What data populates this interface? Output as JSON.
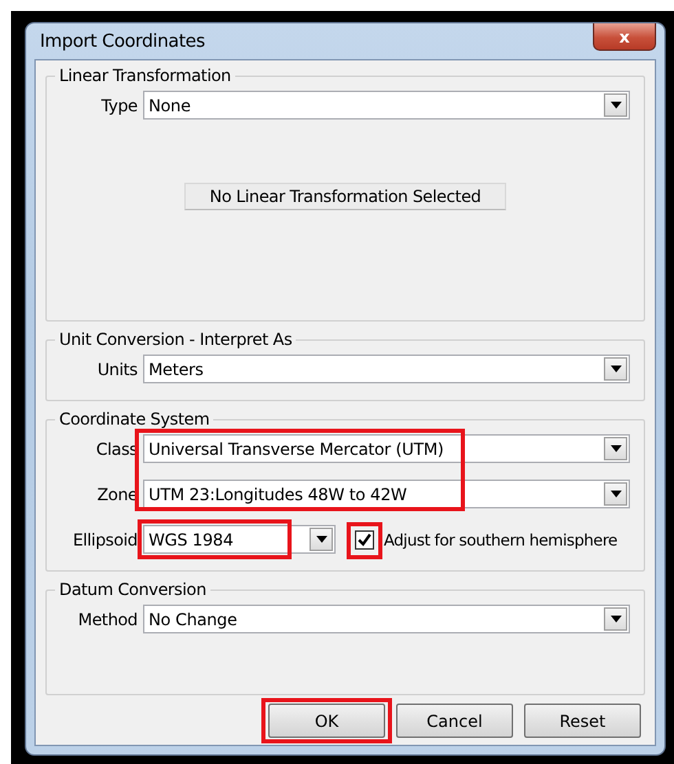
{
  "window": {
    "title": "Import Coordinates",
    "close_label": "x"
  },
  "linear_transformation": {
    "legend": "Linear Transformation",
    "type": {
      "label": "Type",
      "value": "None"
    },
    "status": "No Linear Transformation Selected"
  },
  "unit_conversion": {
    "legend": "Unit Conversion - Interpret As",
    "units": {
      "label": "Units",
      "value": "Meters"
    }
  },
  "coordinate_system": {
    "legend": "Coordinate System",
    "class_zone_highlighted": true,
    "class": {
      "label": "Class",
      "value": "Universal Transverse Mercator (UTM)"
    },
    "zone": {
      "label": "Zone",
      "value": "UTM 23:Longitudes 48W to 42W"
    },
    "ellipsoid": {
      "label": "Ellipsoid",
      "value": "WGS 1984",
      "highlighted": true
    },
    "southern_hemisphere": {
      "label": "Adjust for southern hemisphere",
      "checked": true,
      "highlighted": true
    }
  },
  "datum_conversion": {
    "legend": "Datum Conversion",
    "method": {
      "label": "Method",
      "value": "No Change"
    }
  },
  "buttons": [
    {
      "label": "OK",
      "highlighted": true
    },
    {
      "label": "Cancel",
      "highlighted": false
    },
    {
      "label": "Reset",
      "highlighted": false
    }
  ]
}
